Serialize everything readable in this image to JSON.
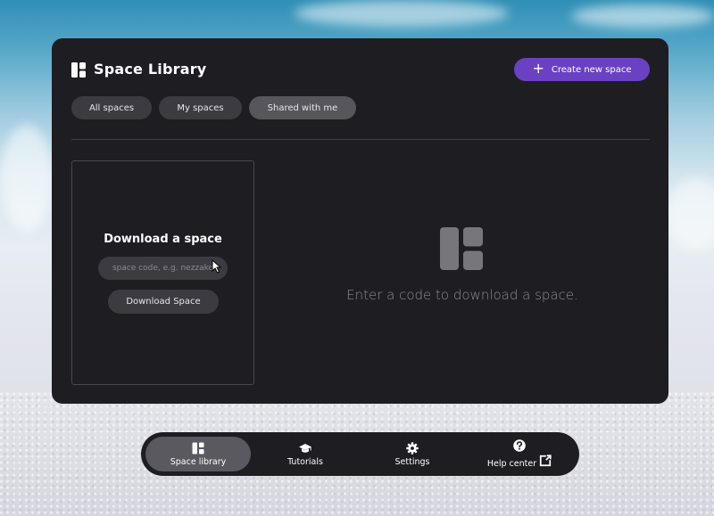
{
  "library": {
    "title": "Space Library",
    "create_label": "Create new space"
  },
  "tabs": [
    {
      "label": "All spaces",
      "active": false
    },
    {
      "label": "My spaces",
      "active": false
    },
    {
      "label": "Shared with me",
      "active": true
    }
  ],
  "download_card": {
    "title": "Download a space",
    "input_placeholder": "space code, e.g. nezzako",
    "input_value": "",
    "button_label": "Download Space"
  },
  "empty_state": {
    "message": "Enter a code to download a space."
  },
  "navbar": {
    "items": [
      {
        "label": "Space library",
        "icon": "space-library-icon",
        "active": true
      },
      {
        "label": "Tutorials",
        "icon": "graduation-cap-icon",
        "active": false
      },
      {
        "label": "Settings",
        "icon": "gear-icon",
        "active": false
      },
      {
        "label": "Help center",
        "icon": "question-circle-icon",
        "active": false,
        "external": true
      }
    ]
  },
  "colors": {
    "panel_bg": "#1e1d22",
    "accent": "#6a41c3",
    "tab_bg": "#3c3b41",
    "tab_active_bg": "#57565c"
  }
}
